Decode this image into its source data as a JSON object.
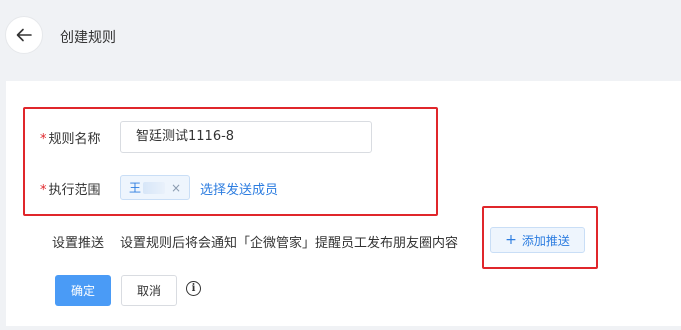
{
  "header": {
    "title": "创建规则",
    "back_icon": "arrow-left-icon"
  },
  "form": {
    "rule_name": {
      "required_mark": "*",
      "label": "规则名称",
      "value": "智廷测试1116-8"
    },
    "scope": {
      "required_mark": "*",
      "label": "执行范围",
      "member_tag": "王",
      "tag_close": "×",
      "select_link": "选择发送成员"
    },
    "push": {
      "label": "设置推送",
      "description": "设置规则后将会通知「企微管家」提醒员工发布朋友圈内容",
      "add_button": "添加推送",
      "add_icon": "+"
    }
  },
  "actions": {
    "confirm": "确定",
    "cancel": "取消",
    "info_icon": "i"
  },
  "colors": {
    "primary": "#4a9bf6",
    "link": "#2d7de0",
    "required": "#e0262b",
    "highlight_box": "#e0262b",
    "background": "#f0f2f5"
  }
}
